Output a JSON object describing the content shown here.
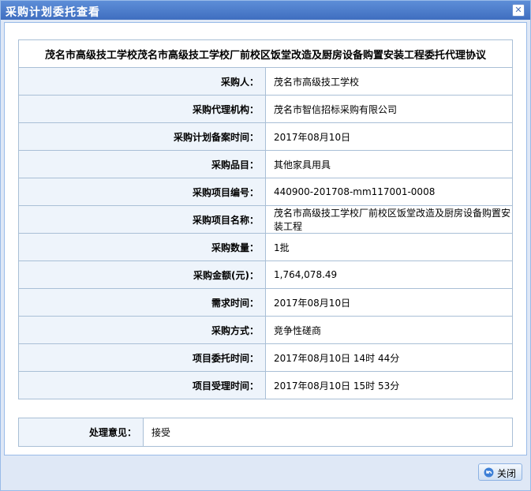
{
  "window": {
    "title": "采购计划委托查看",
    "close_icon": "close-icon"
  },
  "header": "茂名市高级技工学校茂名市高级技工学校厂前校区饭堂改造及厨房设备购置安装工程委托代理协议",
  "rows": [
    {
      "label": "采购人：",
      "value": "茂名市高级技工学校"
    },
    {
      "label": "采购代理机构：",
      "value": "茂名市智信招标采购有限公司"
    },
    {
      "label": "采购计划备案时间：",
      "value": "2017年08月10日"
    },
    {
      "label": "采购品目：",
      "value": "其他家具用具"
    },
    {
      "label": "采购项目编号：",
      "value": "440900-201708-mm117001-0008"
    },
    {
      "label": "采购项目名称：",
      "value": "茂名市高级技工学校厂前校区饭堂改造及厨房设备购置安装工程"
    },
    {
      "label": "采购数量：",
      "value": "1批"
    },
    {
      "label": "采购金额(元)：",
      "value": "1,764,078.49"
    },
    {
      "label": "需求时间：",
      "value": "2017年08月10日"
    },
    {
      "label": "采购方式：",
      "value": "竞争性磋商"
    },
    {
      "label": "项目委托时间：",
      "value": "2017年08月10日 14时 44分"
    },
    {
      "label": "项目受理时间：",
      "value": "2017年08月10日 15时 53分"
    }
  ],
  "opinion": {
    "label": "处理意见：",
    "value": "接受"
  },
  "footer": {
    "close_label": "关闭",
    "close_button_icon": "undo-arrow-icon"
  },
  "colors": {
    "titlebar": "#4a7acb",
    "label_bg": "#eef4fb",
    "border": "#a9bfd6",
    "frame_bg": "#dfe8f6"
  }
}
